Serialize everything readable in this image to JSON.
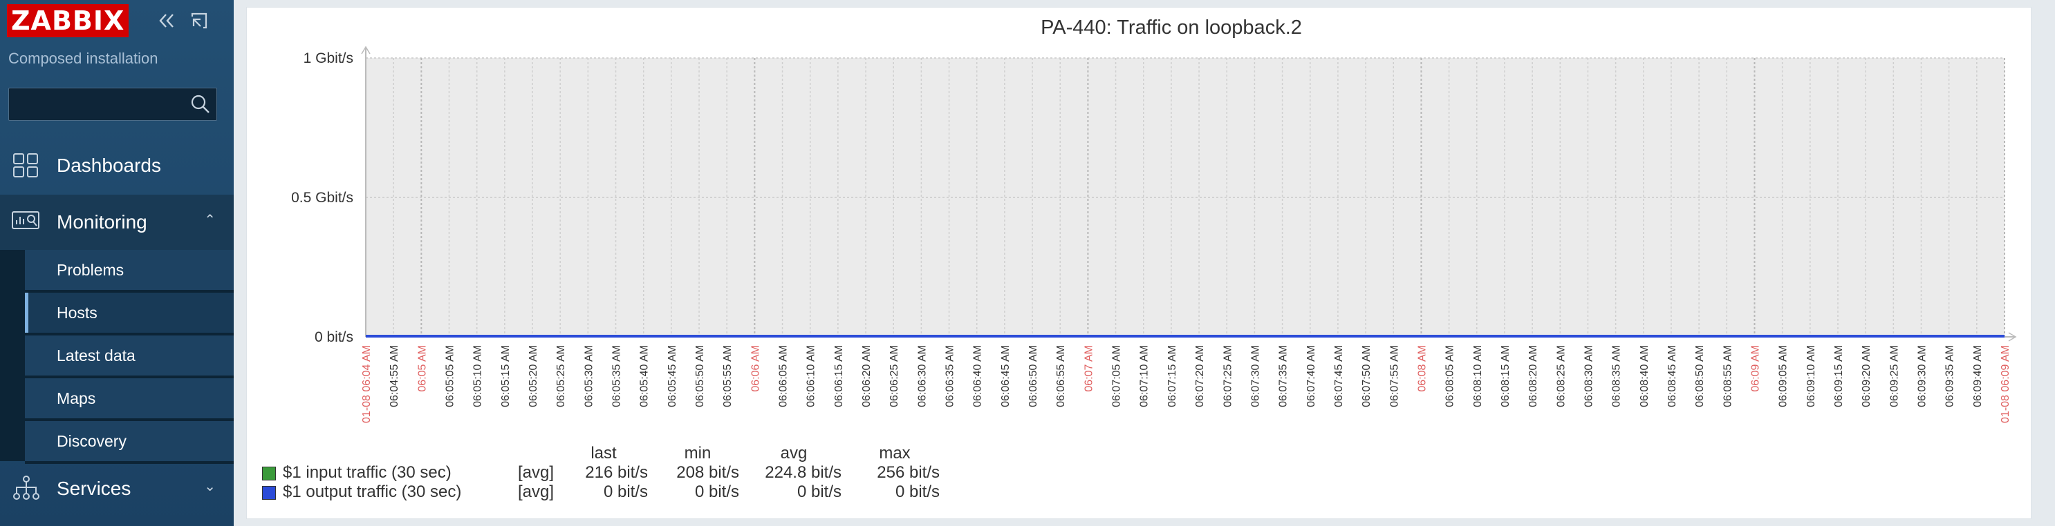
{
  "sidebar": {
    "logo": "ZABBIX",
    "subtitle": "Composed installation",
    "search": {
      "value": "",
      "placeholder": ""
    },
    "menu": [
      {
        "label": "Dashboards",
        "icon": "dashboards-icon"
      },
      {
        "label": "Monitoring",
        "icon": "monitoring-icon",
        "expanded": true
      },
      {
        "label": "Services",
        "icon": "services-icon",
        "expanded": false
      }
    ],
    "submenu": [
      {
        "label": "Problems"
      },
      {
        "label": "Hosts",
        "active": true
      },
      {
        "label": "Latest data"
      },
      {
        "label": "Maps"
      },
      {
        "label": "Discovery"
      }
    ]
  },
  "chart_data": {
    "type": "line",
    "title": "PA-440: Traffic on loopback.2",
    "y_ticks": [
      "1 Gbit/s",
      "0.5 Gbit/s",
      "0 bit/s"
    ],
    "ylim": [
      0,
      1000000000
    ],
    "x_ticks": [
      "01-08 06:04 AM",
      "06:04:55 AM",
      "06:05 AM",
      "06:05:05 AM",
      "06:05:10 AM",
      "06:05:15 AM",
      "06:05:20 AM",
      "06:05:25 AM",
      "06:05:30 AM",
      "06:05:35 AM",
      "06:05:40 AM",
      "06:05:45 AM",
      "06:05:50 AM",
      "06:05:55 AM",
      "06:06 AM",
      "06:06:05 AM",
      "06:06:10 AM",
      "06:06:15 AM",
      "06:06:20 AM",
      "06:06:25 AM",
      "06:06:30 AM",
      "06:06:35 AM",
      "06:06:40 AM",
      "06:06:45 AM",
      "06:06:50 AM",
      "06:06:55 AM",
      "06:07 AM",
      "06:07:05 AM",
      "06:07:10 AM",
      "06:07:15 AM",
      "06:07:20 AM",
      "06:07:25 AM",
      "06:07:30 AM",
      "06:07:35 AM",
      "06:07:40 AM",
      "06:07:45 AM",
      "06:07:50 AM",
      "06:07:55 AM",
      "06:08 AM",
      "06:08:05 AM",
      "06:08:10 AM",
      "06:08:15 AM",
      "06:08:20 AM",
      "06:08:25 AM",
      "06:08:30 AM",
      "06:08:35 AM",
      "06:08:40 AM",
      "06:08:45 AM",
      "06:08:50 AM",
      "06:08:55 AM",
      "06:09 AM",
      "06:09:05 AM",
      "06:09:10 AM",
      "06:09:15 AM",
      "06:09:20 AM",
      "06:09:25 AM",
      "06:09:30 AM",
      "06:09:35 AM",
      "06:09:40 AM",
      "01-08 06:09 AM"
    ],
    "major_ticks": [
      "01-08 06:04 AM",
      "06:05 AM",
      "06:06 AM",
      "06:07 AM",
      "06:08 AM",
      "06:09 AM",
      "01-08 06:09 AM"
    ],
    "colors": {
      "major_tick": "#e06060",
      "input": "#3a9a3a",
      "output": "#2b4bd8"
    },
    "series": [
      {
        "name": "$1 input traffic (30 sec)",
        "agg": "[avg]",
        "last": "216 bit/s",
        "min": "208 bit/s",
        "avg": "224.8 bit/s",
        "max": "256 bit/s",
        "values_bits": [
          216,
          216
        ]
      },
      {
        "name": "$1 output traffic (30 sec)",
        "agg": "[avg]",
        "last": "0 bit/s",
        "min": "0 bit/s",
        "avg": "0 bit/s",
        "max": "0 bit/s",
        "values_bits": [
          0,
          0
        ]
      }
    ],
    "legend_headers": {
      "last": "last",
      "min": "min",
      "avg": "avg",
      "max": "max"
    }
  }
}
